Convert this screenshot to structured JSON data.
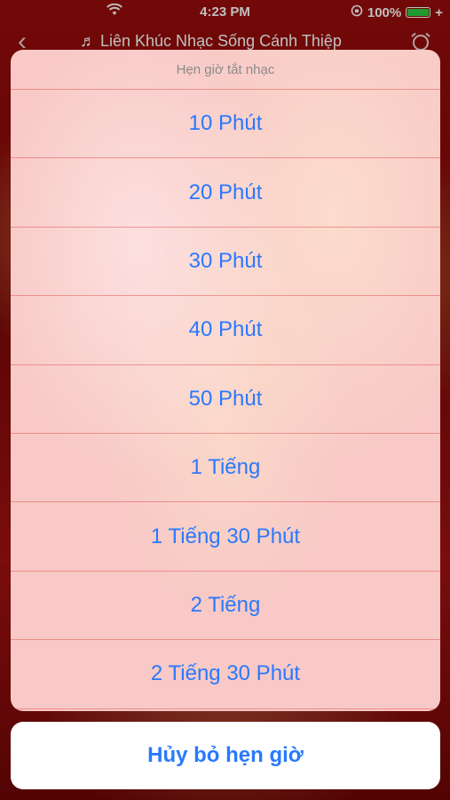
{
  "status_bar": {
    "time": "4:23 PM",
    "battery": "100%"
  },
  "nav": {
    "back_icon": "chevron-left-icon",
    "title": "♬ Liên Khúc Nhạc Sống Cánh Thiệp",
    "alarm_icon": "alarm-clock-icon"
  },
  "action_sheet": {
    "title": "Hẹn giờ tắt nhạc",
    "options": [
      "10 Phút",
      "20 Phút",
      "30 Phút",
      "40 Phút",
      "50 Phút",
      "1 Tiếng",
      "1 Tiếng 30 Phút",
      "2 Tiếng",
      "2 Tiếng 30 Phút"
    ],
    "cancel_label": "Hủy bỏ hẹn giờ",
    "accent_color": "#2979ff"
  }
}
